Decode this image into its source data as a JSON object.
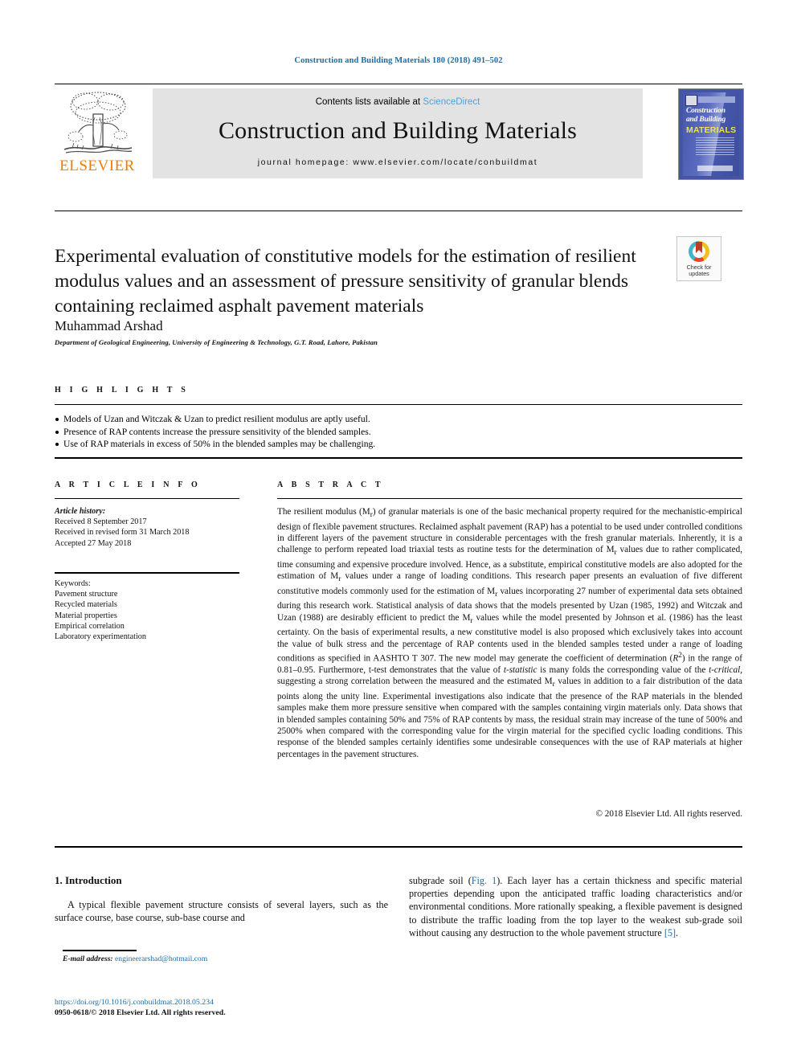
{
  "running_head": "Construction and Building Materials 180 (2018) 491–502",
  "masthead": {
    "publisher": "ELSEVIER",
    "contents_prefix": "Contents lists available at ",
    "contents_link": "ScienceDirect",
    "journal_name": "Construction and Building Materials",
    "homepage": "journal homepage: www.elsevier.com/locate/conbuildmat",
    "cover": {
      "line1": "Construction",
      "line2": "and Building",
      "line3": "MATERIALS"
    }
  },
  "crossmark": {
    "line1": "Check for",
    "line2": "updates"
  },
  "article": {
    "title": "Experimental evaluation of constitutive models for the estimation of resilient modulus values and an assessment of pressure sensitivity of granular blends containing reclaimed asphalt pavement materials",
    "author": "Muhammad Arshad",
    "affiliation": "Department of Geological Engineering, University of Engineering & Technology, G.T. Road, Lahore, Pakistan"
  },
  "highlights": {
    "label": "H I G H L I G H T S",
    "items": [
      "Models of Uzan and Witczak & Uzan to predict resilient modulus are aptly useful.",
      "Presence of RAP contents increase the pressure sensitivity of the blended samples.",
      "Use of RAP materials in excess of 50% in the blended samples may be challenging."
    ]
  },
  "article_info": {
    "label": "A R T I C L E   I N F O",
    "history_label": "Article history:",
    "history": [
      "Received 8 September 2017",
      "Received in revised form 31 March 2018",
      "Accepted 27 May 2018"
    ],
    "keywords_label": "Keywords:",
    "keywords": [
      "Pavement structure",
      "Recycled materials",
      "Material properties",
      "Empirical correlation",
      "Laboratory experimentation"
    ]
  },
  "abstract": {
    "label": "A B S T R A C T",
    "text": "The resilient modulus (Mr) of granular materials is one of the basic mechanical property required for the mechanistic-empirical design of flexible pavement structures. Reclaimed asphalt pavement (RAP) has a potential to be used under controlled conditions in different layers of the pavement structure in considerable percentages with the fresh granular materials. Inherently, it is a challenge to perform repeated load triaxial tests as routine tests for the determination of Mr values due to rather complicated, time consuming and expensive procedure involved. Hence, as a substitute, empirical constitutive models are also adopted for the estimation of Mr values under a range of loading conditions. This research paper presents an evaluation of five different constitutive models commonly used for the estimation of Mr values incorporating 27 number of experimental data sets obtained during this research work. Statistical analysis of data shows that the models presented by Uzan (1985, 1992) and Witczak and Uzan (1988) are desirably efficient to predict the Mr values while the model presented by Johnson et al. (1986) has the least certainty. On the basis of experimental results, a new constitutive model is also proposed which exclusively takes into account the value of bulk stress and the percentage of RAP contents used in the blended samples tested under a range of loading conditions as specified in AASHTO T 307. The new model may generate the coefficient of determination (R2) in the range of 0.81–0.95. Furthermore, t-test demonstrates that the value of t-statistic is many folds the corresponding value of the t-critical, suggesting a strong correlation between the measured and the estimated Mr values in addition to a fair distribution of the data points along the unity line. Experimental investigations also indicate that the presence of the RAP materials in the blended samples make them more pressure sensitive when compared with the samples containing virgin materials only. Data shows that in blended samples containing 50% and 75% of RAP contents by mass, the residual strain may increase of the tune of 500% and 2500% when compared with the corresponding value for the virgin material for the specified cyclic loading conditions. This response of the blended samples certainly identifies some undesirable consequences with the use of RAP materials at higher percentages in the pavement structures.",
    "copyright": "© 2018 Elsevier Ltd. All rights reserved."
  },
  "body": {
    "section_heading": "1. Introduction",
    "paragraph_left": "A typical flexible pavement structure consists of several layers, such as the surface course, base course, sub-base course and",
    "paragraph_right_part1": "subgrade soil (",
    "paragraph_right_figref": "Fig. 1",
    "paragraph_right_part2": "). Each layer has a certain thickness and specific material properties depending upon the anticipated traffic loading characteristics and/or environmental conditions. More rationally speaking, a flexible pavement is designed to distribute the traffic loading from the top layer to the weakest sub-grade soil without causing any destruction to the whole pavement structure ",
    "paragraph_right_ref": "[5]",
    "paragraph_right_end": "."
  },
  "footer": {
    "email_label": "E-mail address:",
    "email": "engineerarshad@hotmail.com",
    "doi": "https://doi.org/10.1016/j.conbuildmat.2018.05.234",
    "issn": "0950-0618/© 2018 Elsevier Ltd. All rights reserved."
  },
  "colors": {
    "link_blue": "#1a6ea8",
    "science_direct_blue": "#4aa3df",
    "elsevier_orange": "#f07d00",
    "band_grey": "#e3e3e3"
  }
}
